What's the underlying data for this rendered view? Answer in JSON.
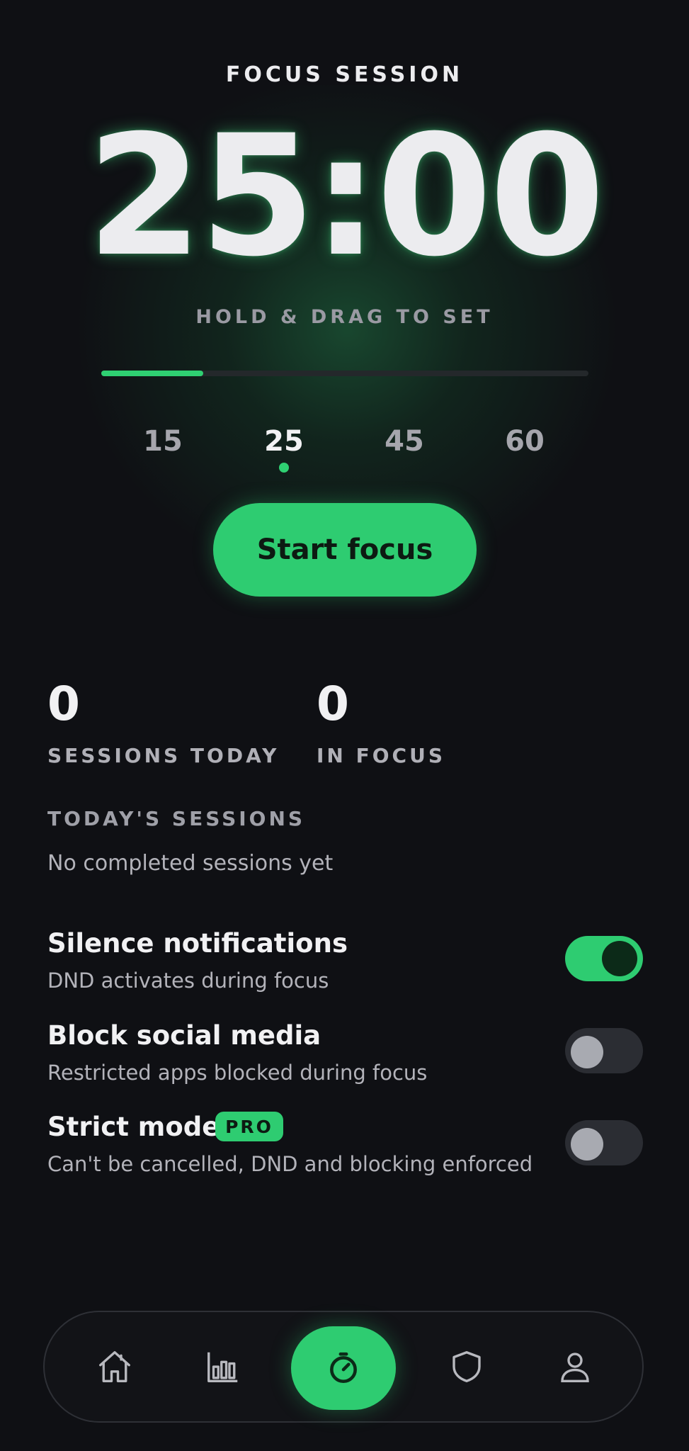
{
  "header": {
    "title": "FOCUS SESSION"
  },
  "timer": {
    "display": "25:00",
    "hint": "HOLD & DRAG TO SET",
    "progress": 0.21
  },
  "presets": [
    {
      "label": "15",
      "active": false
    },
    {
      "label": "25",
      "active": true
    },
    {
      "label": "45",
      "active": false
    },
    {
      "label": "60",
      "active": false
    }
  ],
  "start_button": {
    "label": "Start focus"
  },
  "stats": [
    {
      "value": "0",
      "label": "SESSIONS TODAY"
    },
    {
      "value": "0",
      "label": "IN FOCUS"
    }
  ],
  "sessions": {
    "title": "TODAY'S SESSIONS",
    "empty": "No completed sessions yet"
  },
  "settings": [
    {
      "title": "Silence notifications",
      "subtitle": "DND activates during focus",
      "enabled": true
    },
    {
      "title": "Block social media",
      "subtitle": "Restricted apps blocked during focus",
      "enabled": false
    },
    {
      "title": "Strict mode",
      "badge": "PRO",
      "subtitle": "Can't be cancelled, DND and blocking enforced",
      "enabled": false
    }
  ],
  "nav": [
    {
      "icon": "home-icon"
    },
    {
      "icon": "stats-icon"
    },
    {
      "icon": "timer-icon",
      "active": true
    },
    {
      "icon": "shield-icon"
    },
    {
      "icon": "profile-icon"
    }
  ],
  "colors": {
    "accent": "#2ecc71",
    "background": "#0f1014",
    "toggle_off": "#2b2d33"
  }
}
